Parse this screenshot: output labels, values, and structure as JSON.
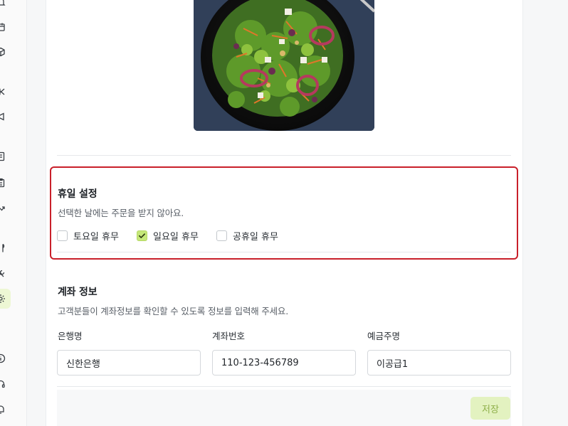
{
  "sidebar": {
    "icons": [
      "bell-icon",
      "calendar-icon",
      "cube-icon",
      "scissors-icon",
      "megaphone-icon",
      "document-icon",
      "clipboard-icon",
      "chart-icon",
      "fork-knife-icon",
      "tools-icon",
      "gear-icon",
      "info-icon",
      "headset-icon",
      "alarm-icon"
    ],
    "active": "gear-icon"
  },
  "holiday": {
    "title": "휴일 설정",
    "description": "선택한 날에는 주문을 받지 않아요.",
    "options": [
      {
        "label": "토요일 휴무",
        "checked": false
      },
      {
        "label": "일요일 휴무",
        "checked": true
      },
      {
        "label": "공휴일 휴무",
        "checked": false
      }
    ]
  },
  "account": {
    "title": "계좌 정보",
    "description": "고객분들이 계좌정보를 확인할 수 있도록 정보를 입력해 주세요.",
    "bank_label": "은행명",
    "bank_value": "신한은행",
    "number_label": "계좌번호",
    "number_value": "110-123-456789",
    "holder_label": "예금주명",
    "holder_value": "이공급1"
  },
  "save_label": "저장",
  "colors": {
    "highlight_border": "#c9202a",
    "accent": "#c5e77a",
    "save_bg": "#e3f2c0"
  }
}
